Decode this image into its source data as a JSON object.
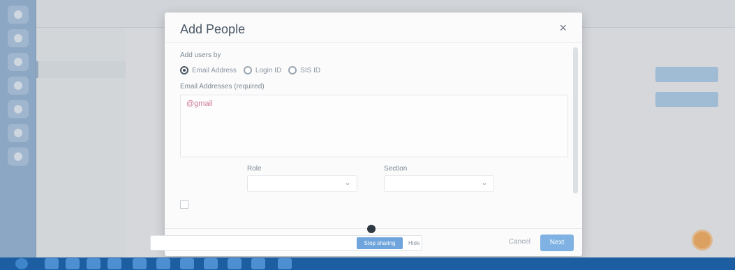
{
  "background": {
    "breadcrumb": "",
    "top_right": "",
    "course_nav_count": 14,
    "right_buttons": [
      "",
      ""
    ]
  },
  "modal": {
    "title": "Add People",
    "close_icon": "×",
    "add_users_by_label": "Add users by",
    "radio_options": [
      {
        "label": "Email Address",
        "selected": true
      },
      {
        "label": "Login ID",
        "selected": false
      },
      {
        "label": "SIS ID",
        "selected": false
      }
    ],
    "email_label": "Email Addresses (required)",
    "email_value": "@gmail",
    "note": "",
    "role_label": "Role",
    "role_value": "",
    "section_label": "Section",
    "section_value": "",
    "checkbox_label": "",
    "cancel_label": "Cancel",
    "next_label": "Next"
  },
  "screen_share": {
    "text": "",
    "stop_label": "Stop sharing",
    "hide_label": "Hide"
  },
  "taskbar": {
    "clock": ""
  },
  "colors": {
    "accent": "#7fb2e3",
    "leftnav": "#8fb0d2",
    "taskbar": "#1d5ea2",
    "help": "#f2a85a"
  }
}
